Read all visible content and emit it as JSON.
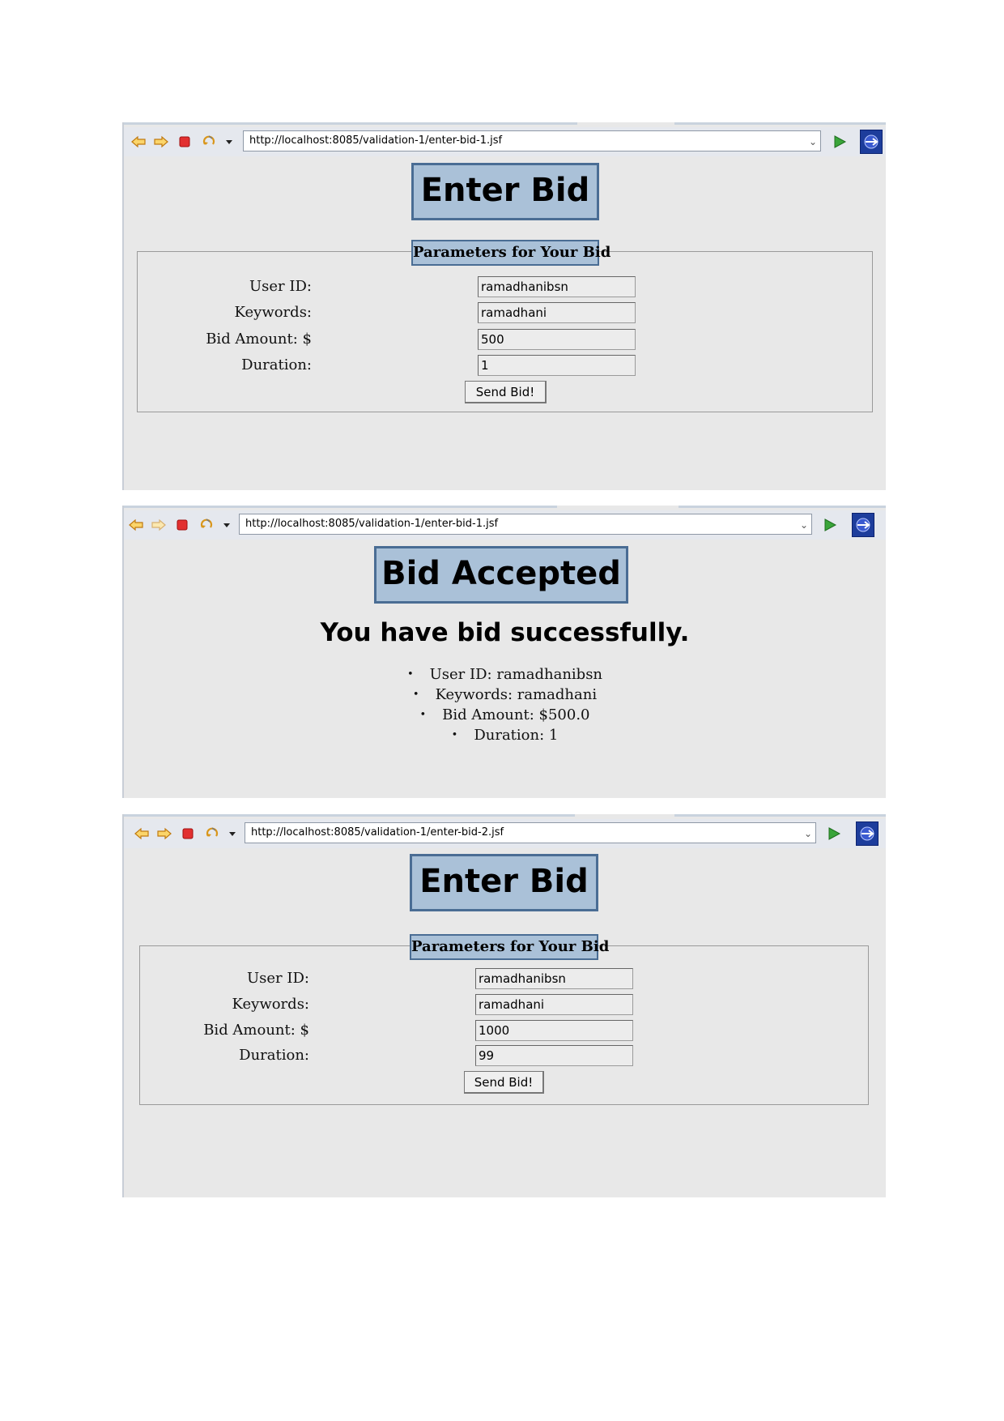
{
  "screens": [
    {
      "url": "http://localhost:8085/validation-1/enter-bid-1.jsf",
      "heading": "Enter Bid",
      "legend": "Parameters for Your Bid",
      "fields": {
        "user_id_label": "User ID:",
        "user_id_value": "ramadhanibsn",
        "keywords_label": "Keywords:",
        "keywords_value": "ramadhani",
        "bid_amount_label": "Bid Amount: $",
        "bid_amount_value": "500",
        "duration_label": "Duration:",
        "duration_value": "1"
      },
      "submit_label": "Send Bid!"
    },
    {
      "url": "http://localhost:8085/validation-1/enter-bid-1.jsf",
      "heading": "Bid Accepted",
      "message": "You have bid successfully.",
      "results": [
        "User ID: ramadhanibsn",
        "Keywords: ramadhani",
        "Bid Amount: $500.0",
        "Duration: 1"
      ]
    },
    {
      "url": "http://localhost:8085/validation-1/enter-bid-2.jsf",
      "heading": "Enter Bid",
      "legend": "Parameters for Your Bid",
      "fields": {
        "user_id_label": "User ID:",
        "user_id_value": "ramadhanibsn",
        "keywords_label": "Keywords:",
        "keywords_value": "ramadhani",
        "bid_amount_label": "Bid Amount: $",
        "bid_amount_value": "1000",
        "duration_label": "Duration:",
        "duration_value": "99"
      },
      "submit_label": "Send Bid!"
    }
  ],
  "toolbar_icons": [
    "back-icon",
    "forward-icon",
    "stop-icon",
    "refresh-icon",
    "dropdown-icon",
    "go-icon",
    "extension-icon"
  ],
  "colors": {
    "page_bg": "#e8e8e8",
    "title_bg": "#aac1d8",
    "title_border": "#4a6d94",
    "toolbar_bg": "#e5e8ee",
    "go_green": "#3aa53a",
    "nav_orange": "#f0a020"
  }
}
